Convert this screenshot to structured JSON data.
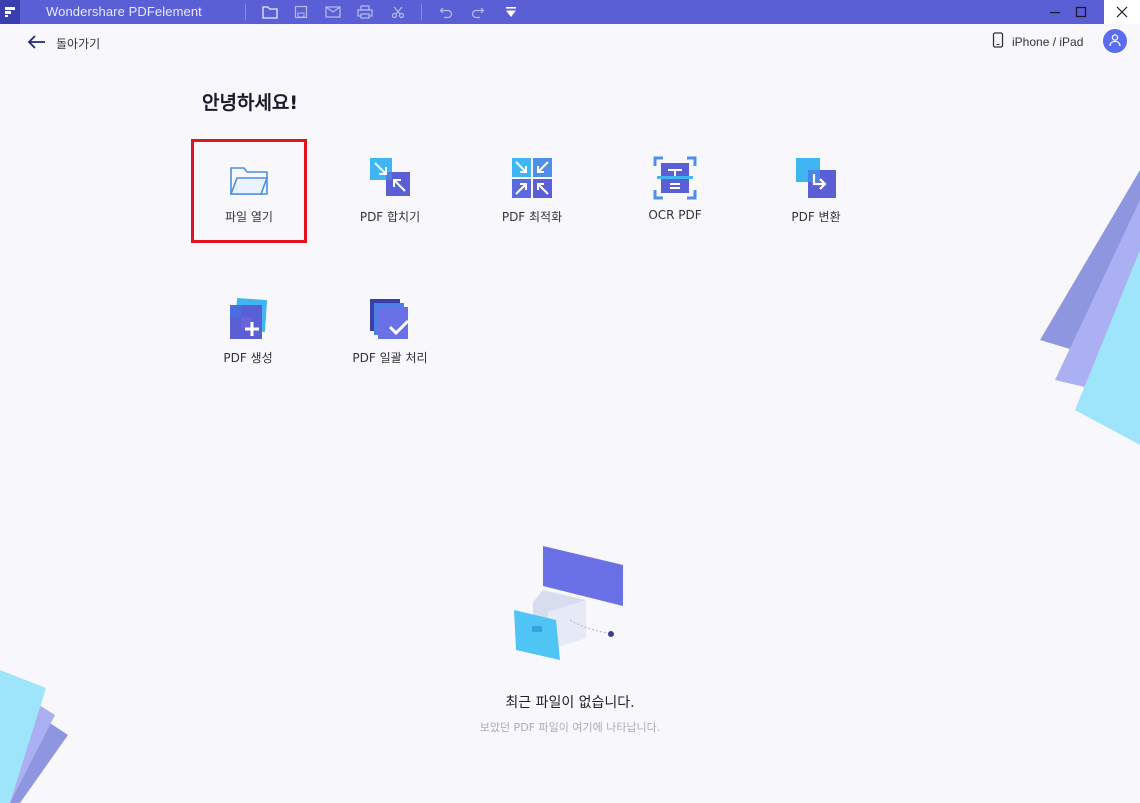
{
  "window": {
    "title": "Wondershare PDFelement",
    "toolbar_icons": [
      "folder-open-icon",
      "save-icon",
      "mail-icon",
      "print-icon",
      "scissors-icon",
      "undo-icon",
      "redo-icon",
      "dropdown-icon"
    ],
    "controls": [
      "minimize",
      "maximize",
      "close"
    ]
  },
  "header": {
    "back_label": "돌아가기",
    "device_label": "iPhone / iPad"
  },
  "greeting": "안녕하세요!",
  "tiles": [
    {
      "label": "파일 열기",
      "icon": "folder-open-icon",
      "highlighted": true
    },
    {
      "label": "PDF 합치기",
      "icon": "combine-icon"
    },
    {
      "label": "PDF 최적화",
      "icon": "optimize-icon"
    },
    {
      "label": "OCR PDF",
      "icon": "ocr-icon"
    },
    {
      "label": "PDF 변환",
      "icon": "convert-icon"
    },
    {
      "label": "PDF 생성",
      "icon": "create-icon"
    },
    {
      "label": "PDF 일괄 처리",
      "icon": "batch-icon"
    }
  ],
  "recent": {
    "empty_title": "최근 파일이 없습니다.",
    "empty_subtitle": "보았던 PDF 파일이 여기에 나타납니다."
  },
  "colors": {
    "titlebar": "#5a5fd6",
    "accent": "#5a6cf0",
    "highlight_border": "#e0161e",
    "background": "#f8f8fc"
  }
}
